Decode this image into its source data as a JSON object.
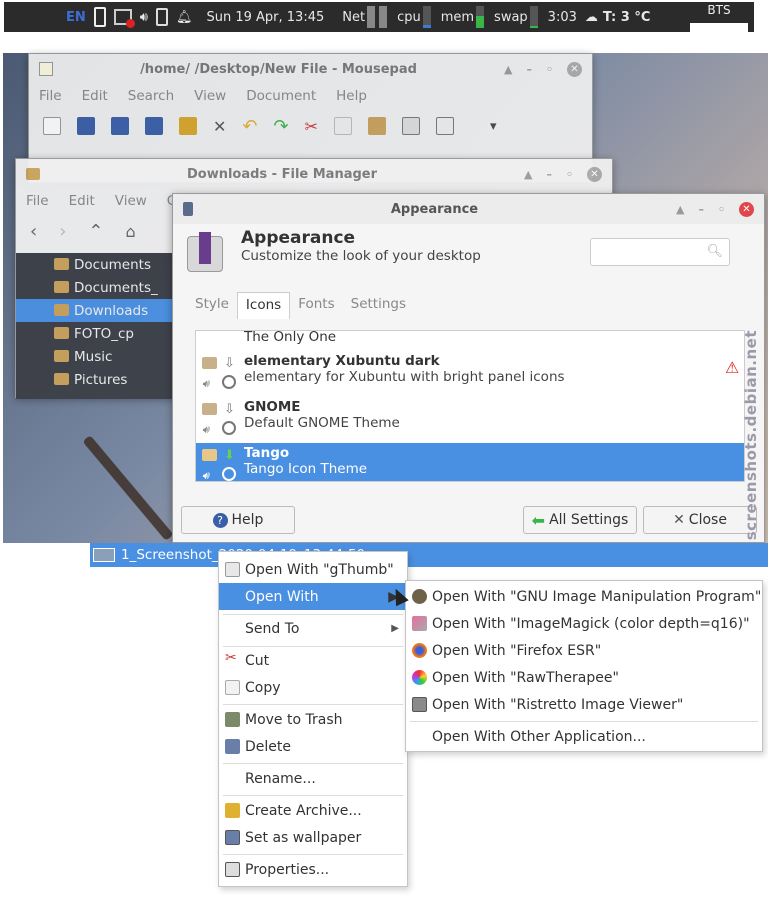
{
  "panel": {
    "lang": "EN",
    "datetime": "Sun 19 Apr, 13:45",
    "net_label": "Net",
    "cpu_label": "cpu",
    "cpu_level": 0.15,
    "mem_label": "mem",
    "mem_level": 0.55,
    "swap_label": "swap",
    "swap_level": 0.1,
    "battery_time": "3:03",
    "temp": "T: 3 °C",
    "bts": "BTS"
  },
  "mousepad": {
    "title": "/home/        /Desktop/New File - Mousepad",
    "menu": [
      "File",
      "Edit",
      "Search",
      "View",
      "Document",
      "Help"
    ]
  },
  "filemanager": {
    "title": "Downloads - File Manager",
    "menu": [
      "File",
      "Edit",
      "View",
      "Go"
    ],
    "sidebar": [
      "Documents",
      "Documents_",
      "Downloads",
      "FOTO_cp",
      "Music",
      "Pictures"
    ],
    "selected_index": 2
  },
  "appearance": {
    "title": "Appearance",
    "header_title": "Appearance",
    "header_subtitle": "Customize the look of your desktop",
    "tabs": [
      "Style",
      "Icons",
      "Fonts",
      "Settings"
    ],
    "active_tab": 1,
    "themes": [
      {
        "name": "The Only One",
        "desc": ""
      },
      {
        "name": "elementary Xubuntu dark",
        "desc": "elementary for Xubuntu with bright panel icons"
      },
      {
        "name": "GNOME",
        "desc": "Default GNOME Theme"
      },
      {
        "name": "Tango",
        "desc": "Tango Icon Theme"
      }
    ],
    "selected_theme": 3,
    "help_label": "Help",
    "all_settings_label": "All Settings",
    "close_label": "Close"
  },
  "file_bar": {
    "filename": "1_Screenshot_2020-04-19_13-44-50.png"
  },
  "context_menu": {
    "items": [
      "Open With \"gThumb\"",
      "Open With",
      "Send To",
      "Cut",
      "Copy",
      "Move to Trash",
      "Delete",
      "Rename...",
      "Create Archive...",
      "Set as wallpaper",
      "Properties..."
    ]
  },
  "submenu": {
    "items": [
      "Open With \"GNU Image Manipulation Program\"",
      "Open With \"ImageMagick (color depth=q16)\"",
      "Open With \"Firefox ESR\"",
      "Open With \"RawTherapee\"",
      "Open With \"Ristretto Image Viewer\"",
      "Open With Other Application..."
    ]
  },
  "watermark": "screenshots.debian.net",
  "colors": {
    "selection": "#4a90e2",
    "panel": "#2b2b2b",
    "sidebar": "#3c3f46"
  }
}
